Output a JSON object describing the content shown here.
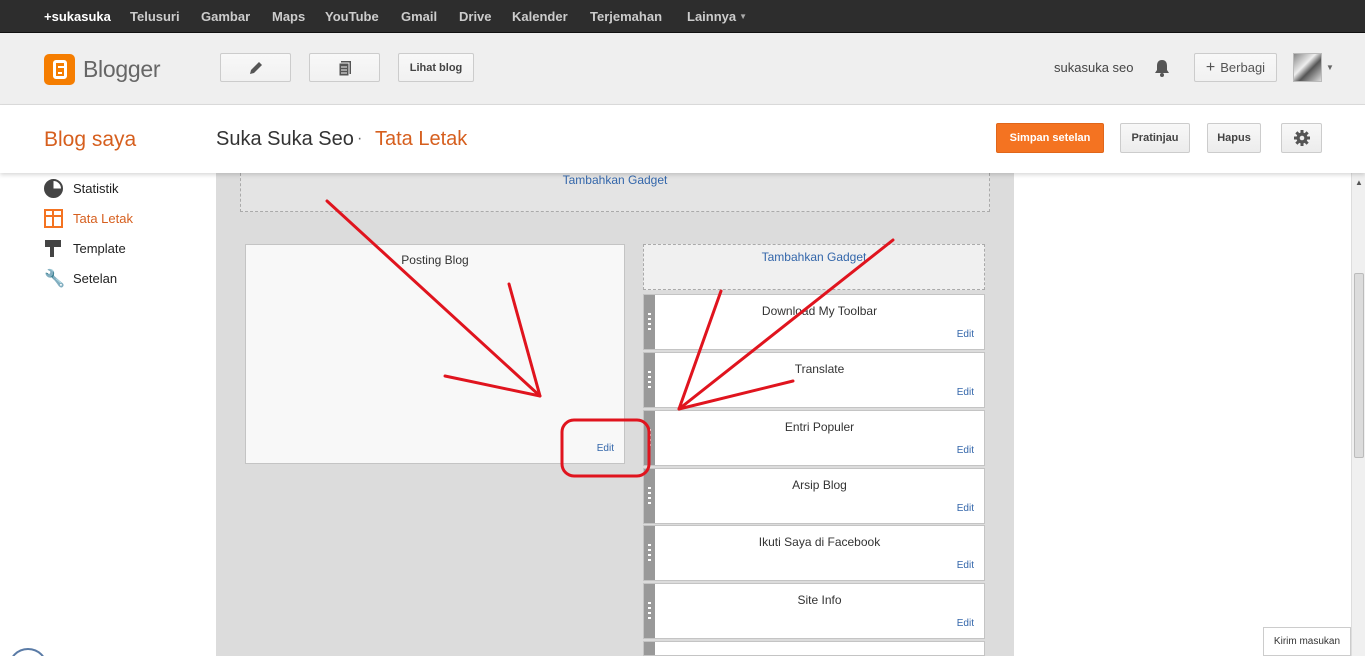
{
  "gbar": {
    "links": [
      "+sukasuka",
      "Telusuri",
      "Gambar",
      "Maps",
      "YouTube",
      "Gmail",
      "Drive",
      "Kalender",
      "Terjemahan",
      "Lainnya"
    ]
  },
  "header": {
    "logo_text": "Blogger",
    "new_post_icon": "pencil-icon",
    "pages_icon": "pages-icon",
    "view_blog_label": "Lihat blog",
    "user_name": "sukasuka seo",
    "bell_icon": "bell-icon",
    "share_label": "Berbagi"
  },
  "subheader": {
    "blog_saya": "Blog saya",
    "blog_title": "Suka Suka Seo",
    "separator": "·",
    "page_title": "Tata Letak",
    "save_label": "Simpan setelan",
    "preview_label": "Pratinjau",
    "delete_label": "Hapus"
  },
  "sidebar": {
    "items": [
      {
        "label": "Statistik",
        "icon": "stats-icon"
      },
      {
        "label": "Tata Letak",
        "icon": "layout-icon",
        "active": true
      },
      {
        "label": "Template",
        "icon": "template-icon"
      },
      {
        "label": "Setelan",
        "icon": "wrench-icon"
      }
    ]
  },
  "layout": {
    "header_add_gadget": "Tambahkan Gadget",
    "post_box_title": "Posting Blog",
    "edit_label": "Edit",
    "side_add_gadget": "Tambahkan Gadget",
    "gadgets": [
      {
        "title": "Download My Toolbar"
      },
      {
        "title": "Translate"
      },
      {
        "title": "Entri Populer"
      },
      {
        "title": "Arsip Blog"
      },
      {
        "title": "Ikuti Saya di Facebook"
      },
      {
        "title": "Site Info"
      }
    ]
  },
  "feedback_label": "Kirim masukan",
  "colors": {
    "accent": "#f47321",
    "link": "#3366aa",
    "annotation": "#e0141e"
  }
}
